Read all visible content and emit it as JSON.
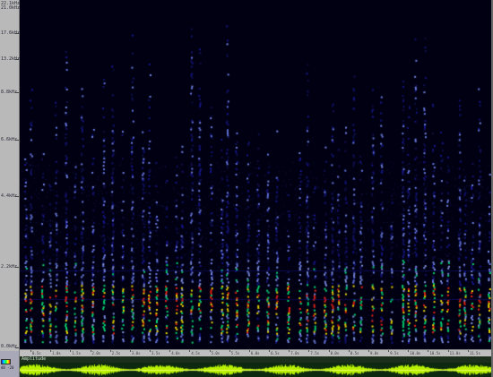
{
  "freq_ruler": {
    "top_labels": [
      "22.1kHz",
      "21.0kHz"
    ],
    "ticks": [
      "17.6kHz",
      "13.2kHz",
      "8.8kHz",
      "6.6kHz",
      "4.4kHz",
      "2.2kHz",
      "0.0kHz"
    ]
  },
  "time_ruler": {
    "ticks": [
      "0.5s",
      "1.0s",
      "1.5s",
      "2.0s",
      "2.5s",
      "3.0s",
      "3.5s",
      "4.0s",
      "4.5s",
      "5.0s",
      "5.5s",
      "6.0s",
      "6.5s",
      "7.0s",
      "7.5s",
      "8.0s",
      "8.5s",
      "9.0s",
      "9.5s",
      "10.0s",
      "10.5s",
      "11.0s",
      "11.5s"
    ]
  },
  "bottom_left": {
    "mini_label": "dB -20"
  },
  "amplitude_bar": {
    "label": "Amplitude"
  },
  "colors": {
    "spectrogram_bg": "#000012",
    "low": "#1a1aff",
    "mid": "#00e0ff",
    "high": "#ffff00",
    "peak": "#ff2000",
    "waveform": "#b8f000"
  },
  "icons": {
    "palette": "colormap-icon"
  }
}
